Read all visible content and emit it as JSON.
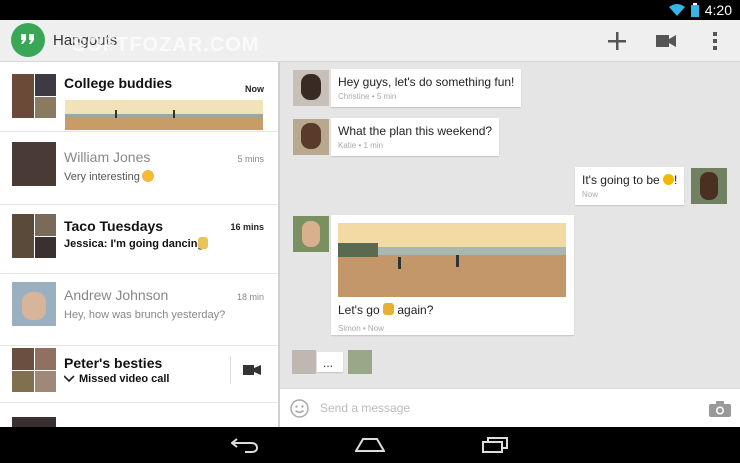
{
  "status": {
    "time": "4:20"
  },
  "app": {
    "title": "Hangouts",
    "watermark": "SOFTFOZAR.COM"
  },
  "conversations": [
    {
      "name": "College buddies",
      "snippet": "",
      "time": "Now",
      "unread": true
    },
    {
      "name": "William Jones",
      "snippet": "Very interesting",
      "time": "5 mins",
      "unread": false
    },
    {
      "name": "Taco Tuesdays",
      "snippet": "Jessica: I'm going dancing!",
      "time": "16 mins",
      "unread": true
    },
    {
      "name": "Andrew Johnson",
      "snippet": "Hey, how was brunch yesterday?",
      "time": "18 min",
      "unread": false
    },
    {
      "name": "Peter's besties",
      "snippet": "Missed video call",
      "time": "",
      "unread": true
    }
  ],
  "messages": [
    {
      "text": "Hey guys, let's do something fun!",
      "meta": "Christine • 5 min"
    },
    {
      "text": "What the plan this weekend?",
      "meta": "Katie • 1 min"
    },
    {
      "text": "It's going to be",
      "meta": "Now"
    },
    {
      "text": "Let's go",
      "text_after": "again?",
      "meta": "Simon • Now"
    }
  ],
  "typing": {
    "text": "..."
  },
  "composer": {
    "placeholder": "Send a message"
  }
}
